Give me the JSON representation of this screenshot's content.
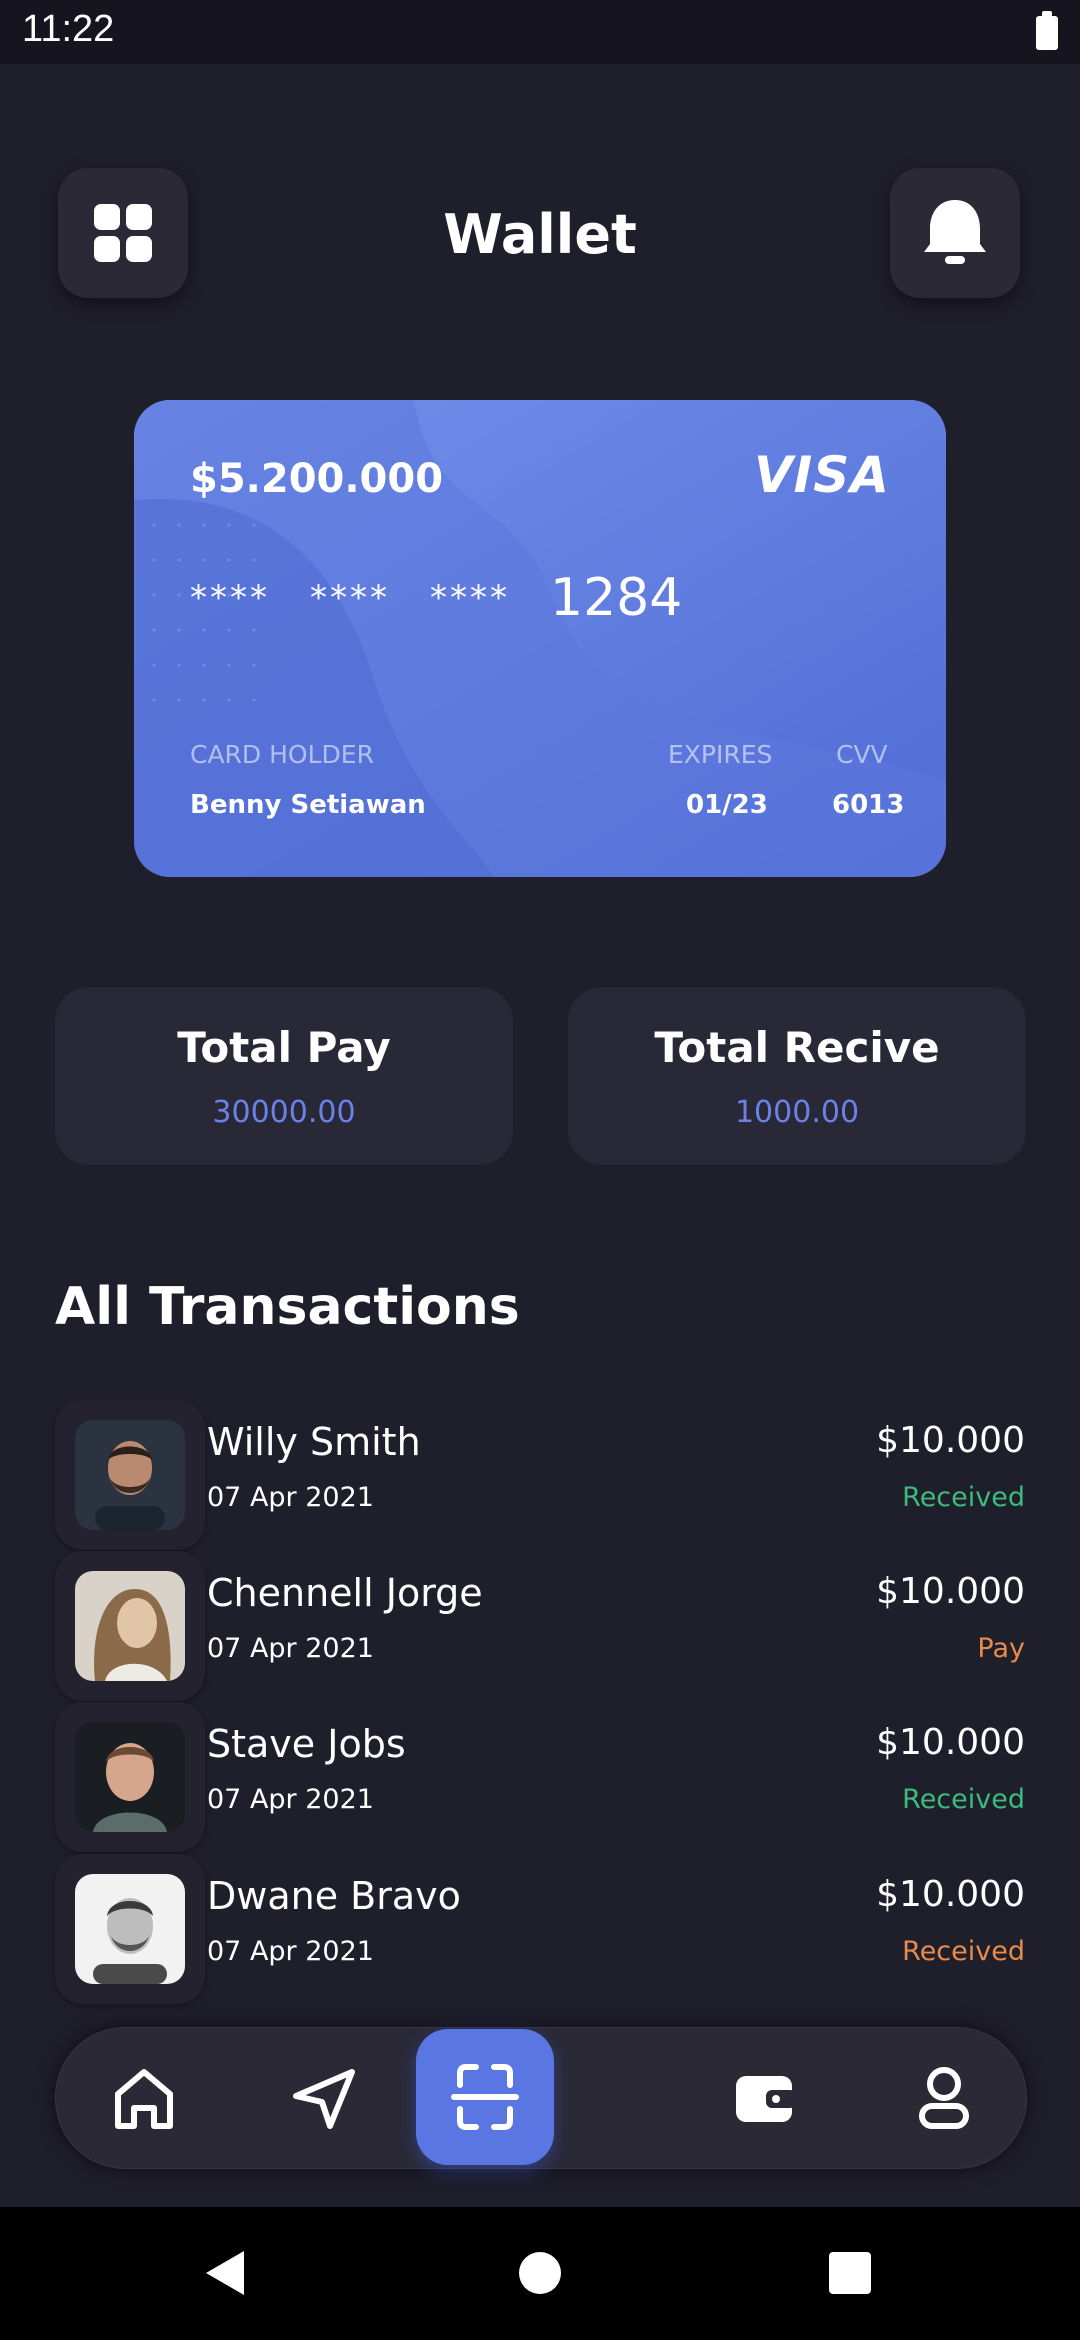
{
  "status_bar": {
    "time": "11:22"
  },
  "header": {
    "title": "Wallet",
    "menu_icon": "grid-icon",
    "bell_icon": "bell-icon"
  },
  "card": {
    "balance": "$5.200.000",
    "brand": "VISA",
    "mask_1": "****",
    "mask_2": "****",
    "mask_3": "****",
    "last_digits": "1284",
    "holder_label": "CARD HOLDER",
    "holder_name": "Benny Setiawan",
    "expires_label": "EXPIRES",
    "expires_value": "01/23",
    "cvv_label": "CVV",
    "cvv_value": "6013"
  },
  "summary": {
    "pay_label": "Total Pay",
    "pay_value": "30000.00",
    "receive_label": "Total Recive",
    "receive_value": "1000.00"
  },
  "transactions_title": "All Transactions",
  "transactions": [
    {
      "name": "Willy Smith",
      "date": "07 Apr 2021",
      "amount": "$10.000",
      "status": "Received",
      "status_color": "#3dbb7c"
    },
    {
      "name": "Chennell Jorge",
      "date": "07 Apr 2021",
      "amount": "$10.000",
      "status": "Pay",
      "status_color": "#e88a4a"
    },
    {
      "name": "Stave Jobs",
      "date": "07 Apr 2021",
      "amount": "$10.000",
      "status": "Received",
      "status_color": "#3dbb7c"
    },
    {
      "name": "Dwane Bravo",
      "date": "07 Apr 2021",
      "amount": "$10.000",
      "status": "Received",
      "status_color": "#e88a4a"
    }
  ],
  "bottom_nav": [
    "home-icon",
    "send-icon",
    "scan-icon",
    "wallet-icon",
    "profile-icon"
  ],
  "colors": {
    "accent": "#5a76e3",
    "background": "#1f1e2b",
    "received": "#3dbb7c",
    "pay": "#e88a4a"
  }
}
